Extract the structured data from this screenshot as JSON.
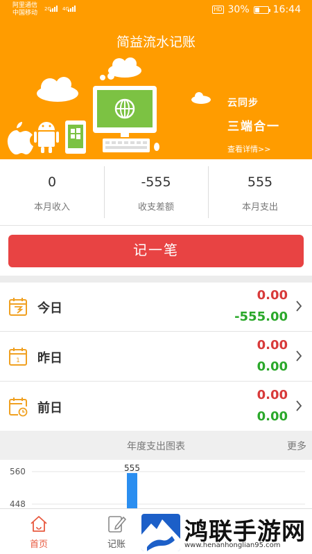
{
  "status_bar": {
    "carrier_1": "阿里通信",
    "carrier_2": "中国移动",
    "net_1": "2G",
    "net_2": "4G",
    "hd": "HD",
    "battery": "30%",
    "time": "16:44"
  },
  "header": {
    "title": "简益流水记账",
    "promo_line_1": "云同步",
    "promo_line_2": "三端合一",
    "promo_link": "查看详情>>"
  },
  "summary": [
    {
      "value": "0",
      "label": "本月收入"
    },
    {
      "value": "-555",
      "label": "收支差额"
    },
    {
      "value": "555",
      "label": "本月支出"
    }
  ],
  "record_button": "记一笔",
  "days": [
    {
      "label": "今日",
      "income": "0.00",
      "expense": "-555.00"
    },
    {
      "label": "昨日",
      "income": "0.00",
      "expense": "0.00"
    },
    {
      "label": "前日",
      "income": "0.00",
      "expense": "0.00"
    }
  ],
  "chart_section": {
    "title": "年度支出图表",
    "more": "更多"
  },
  "chart_data": {
    "type": "bar",
    "title": "年度支出图表",
    "y_ticks": [
      560,
      448
    ],
    "values": [
      555
    ],
    "data_labels": [
      "555"
    ],
    "bar_color": "#2a8ef0"
  },
  "tabs": [
    {
      "label": "首页",
      "icon": "home-icon",
      "active": true
    },
    {
      "label": "记账",
      "icon": "edit-icon",
      "active": false
    }
  ],
  "watermark": {
    "text": "鸿联手游网",
    "url": "www.henanhonglian95.com"
  },
  "colors": {
    "brand_orange": "#ff9c00",
    "record_red": "#e84343",
    "income_red": "#d83a3a",
    "expense_green": "#2aa82a",
    "tab_active": "#e8593f"
  }
}
